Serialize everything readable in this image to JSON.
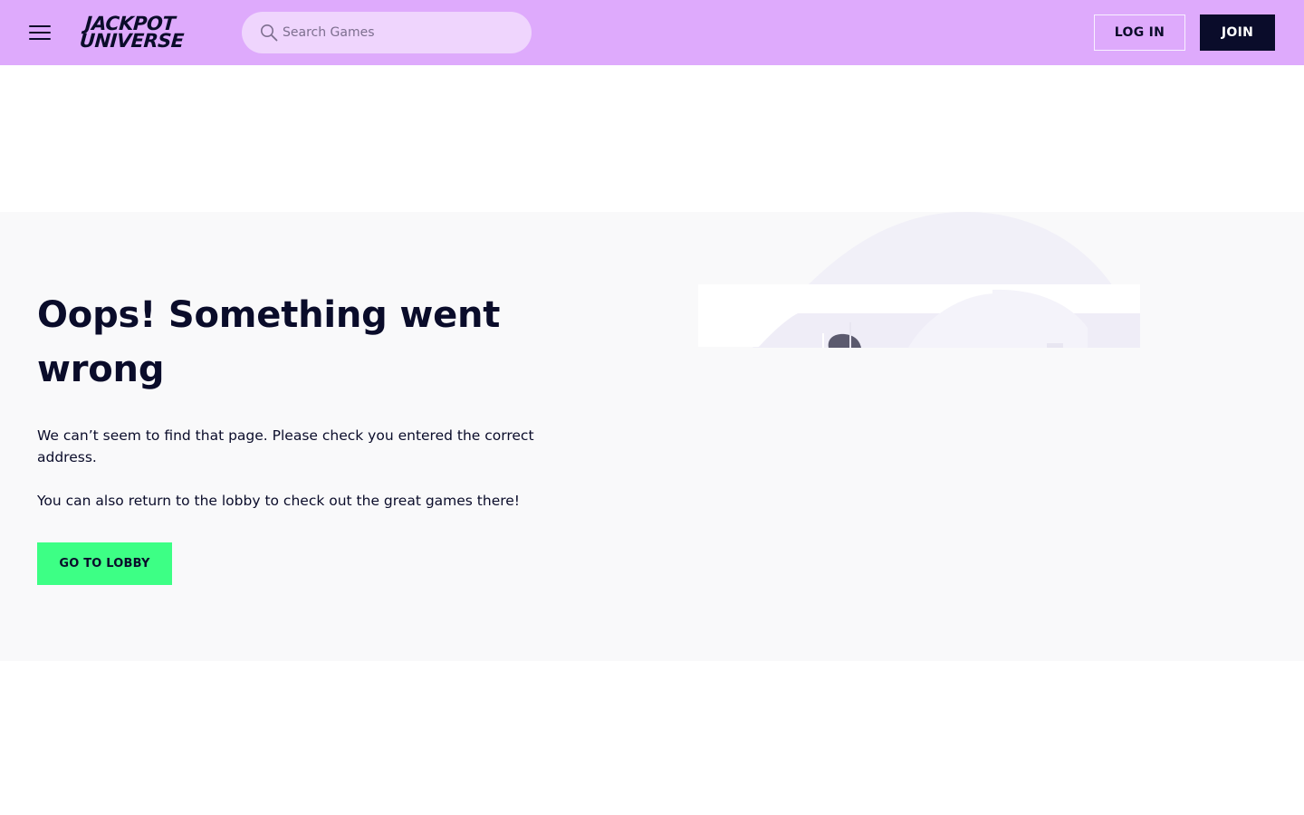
{
  "header": {
    "menu_icon": "hamburger-menu-icon",
    "logo": {
      "line1": "JACKPOT",
      "line2": "UNIVERSE"
    },
    "search": {
      "placeholder": "Search Games",
      "value": "",
      "icon": "search-icon"
    },
    "login_label": "LOG IN",
    "join_label": "JOIN"
  },
  "error": {
    "title": "Oops! Something went wrong",
    "paragraph1": "We can’t seem to find that page. Please check you entered the correct address.",
    "paragraph2": "You can also return to the lobby to check out the great games there!",
    "lobby_button": "GO TO LOBBY"
  },
  "colors": {
    "header_bg": "#deaafc",
    "search_bg": "#efd5fd",
    "brand_dark": "#0a0c2a",
    "lobby_button_bg": "#3dff85",
    "section_bg": "#f9f9fa"
  }
}
